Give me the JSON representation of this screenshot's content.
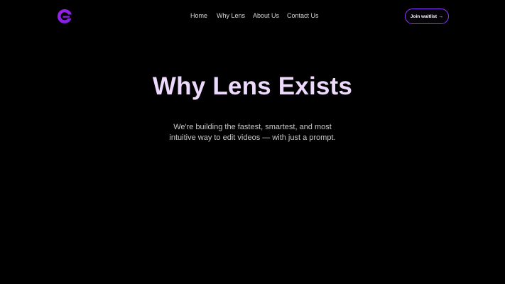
{
  "brand": {
    "logo_icon": "lens-logo-icon",
    "accent_color": "#8b3dff"
  },
  "nav": {
    "items": [
      {
        "label": "Home"
      },
      {
        "label": "Why Lens"
      },
      {
        "label": "About Us"
      },
      {
        "label": "Contact Us"
      }
    ]
  },
  "cta": {
    "label": "Join waitlist",
    "arrow": "→"
  },
  "hero": {
    "title": "Why Lens Exists",
    "subtitle_line1": "We're building the fastest, smartest, and most",
    "subtitle_line2": "intuitive way to edit videos — with just a prompt."
  }
}
